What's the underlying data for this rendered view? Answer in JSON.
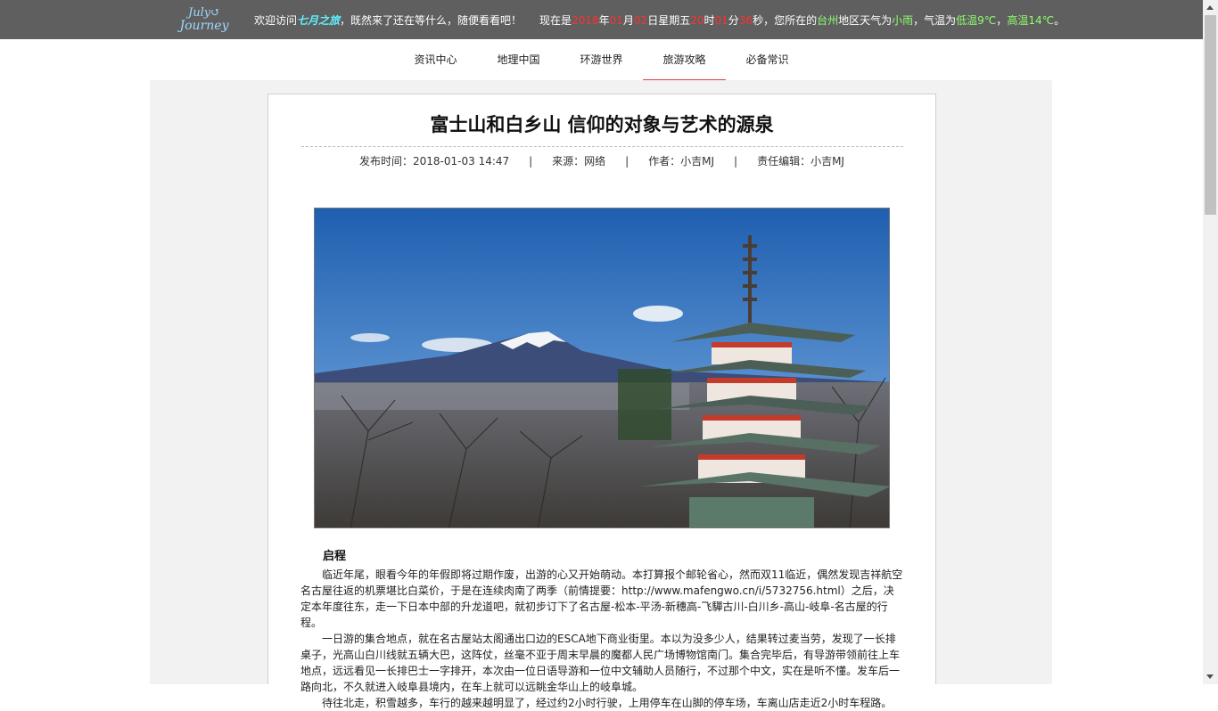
{
  "header": {
    "logo_line1": "July↺",
    "logo_line2": "Journey",
    "welcome_prefix": "欢迎访问",
    "site_name": "七月之旅",
    "welcome_suffix": "，既然来了还在等什么，随便看看吧！",
    "time_prefix": "现在是",
    "year": "2018",
    "year_unit": "年",
    "month": "01",
    "month_unit": "月",
    "day": "02",
    "day_unit": "日星期五",
    "hour": "20",
    "hour_unit": "时",
    "minute": "01",
    "minute_unit": "分",
    "second": "36",
    "second_unit": "秒，您所在的",
    "city": "台州",
    "weather_prefix": "地区天气为",
    "weather": "小雨",
    "temp_prefix": "，气温为",
    "low_temp": "低温9℃",
    "comma": "，",
    "high_temp": "高温14℃",
    "period": "。"
  },
  "nav": {
    "items": [
      {
        "label": "资讯中心"
      },
      {
        "label": "地理中国"
      },
      {
        "label": "环游世界"
      },
      {
        "label": "旅游攻略"
      },
      {
        "label": "必备常识"
      }
    ],
    "active_index": 3
  },
  "article": {
    "title": "富士山和白乡山 信仰的对象与艺术的源泉",
    "publish_time": "发布时间：2018-01-03 14:47",
    "separator": "|",
    "source": "来源：网络",
    "author": "作者：小吉MJ",
    "editor": "责任编辑：小吉MJ",
    "section_heading": "启程",
    "paragraphs": [
      "临近年尾，眼看今年的年假即将过期作废，出游的心又开始萌动。本打算报个邮轮省心，然而双11临近，偶然发现吉祥航空名古屋往返的机票堪比白菜价，于是在连续肉南了两季（前情提要：http://www.mafengwo.cn/i/5732756.html）之后，决定本年度往东，走一下日本中部的升龙道吧，就初步订下了名古屋-松本-平汤-新穗高-飞驒古川-白川乡-高山-岐阜-名古屋的行程。",
      "一日游的集合地点，就在名古屋站太阁通出口边的ESCA地下商业街里。本以为没多少人，结果转过麦当劳，发现了一长排桌子，光高山白川线就五辆大巴，这阵仗，丝毫不亚于周末早晨的魔都人民广场博物馆南门。集合完毕后，有导游带领前往上车地点，远远看见一长排巴士一字排开，本次由一位日语导游和一位中文辅助人员随行，不过那个中文，实在是听不懂。发车后一路向北，不久就进入岐阜县境内，在车上就可以远眺金华山上的岐阜城。",
      "待往北走，积雪越多，车行的越来越明显了，经过约2小时行驶，上用停车在山脚的停车场，车离山店走近2小时车程路。"
    ]
  },
  "colors": {
    "topbar": "#5f5f5f",
    "accent_red": "#ff3030",
    "site_name": "#5ff0ff",
    "temp_green": "#8fff70",
    "nav_active": "#e43f3f"
  }
}
